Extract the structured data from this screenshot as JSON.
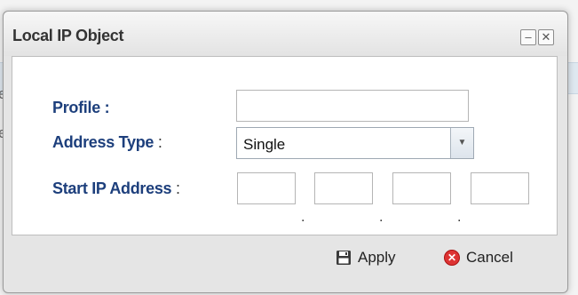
{
  "dialog": {
    "title": "Local IP Object",
    "minimize_glyph": "–",
    "close_glyph": "✕"
  },
  "background": {
    "peek_letter_1": "e",
    "peek_letter_2": "e"
  },
  "form": {
    "profile_label": "Profile :",
    "profile_value": "",
    "address_type_label": "Address Type",
    "address_type_colon": ":",
    "address_type_value": "Single",
    "start_ip_label": "Start IP Address",
    "start_ip_colon": ":",
    "ip_octets": [
      "",
      "",
      "",
      ""
    ],
    "dot": "."
  },
  "footer": {
    "apply_label": "Apply",
    "cancel_label": "Cancel"
  },
  "icons": {
    "apply": "save-icon",
    "cancel": "cancel-icon",
    "dropdown": "chevron-down-icon"
  }
}
